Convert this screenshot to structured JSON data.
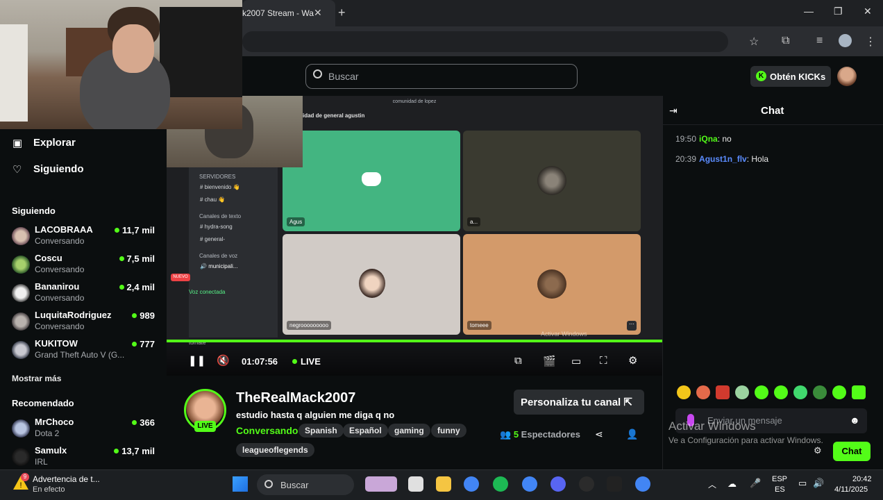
{
  "browser": {
    "tab_title": "k2007 Stream - Wa",
    "new_tab": "+",
    "close_tab": "✕",
    "window_controls": [
      "—",
      "❐",
      "✕"
    ]
  },
  "header": {
    "search_placeholder": "Buscar",
    "kicks_button": "Obtén KICKs"
  },
  "sidebar": {
    "nav": [
      {
        "label": "Explorar",
        "icon": "compass-icon"
      },
      {
        "label": "Siguiendo",
        "icon": "heart-icon"
      }
    ],
    "following_title": "Siguiendo",
    "following": [
      {
        "name": "LACOBRAAA",
        "category": "Conversando",
        "viewers": "11,7 mil"
      },
      {
        "name": "Coscu",
        "category": "Conversando",
        "viewers": "7,5 mil"
      },
      {
        "name": "Bananirou",
        "category": "Conversando",
        "viewers": "2,4 mil"
      },
      {
        "name": "LuquitaRodriguez",
        "category": "Conversando",
        "viewers": "989"
      },
      {
        "name": "KUKITOW",
        "category": "Grand Theft Auto V (G...",
        "viewers": "777"
      }
    ],
    "show_more": "Mostrar más",
    "recommended_title": "Recomendado",
    "recommended": [
      {
        "name": "MrChoco",
        "category": "Dota 2",
        "viewers": "366"
      },
      {
        "name": "Samulx",
        "category": "IRL",
        "viewers": "13,7 mil"
      }
    ]
  },
  "player": {
    "discord_window_title": "comunidad de lopez",
    "discord_channel_header": "idad de general agustin",
    "servers_label": "SERVIDORES",
    "channels": [
      "bienvenido 👋",
      "chau 👋"
    ],
    "text_channels_label": "Canales de texto",
    "text_channels": [
      "hydra-song",
      "general-"
    ],
    "voice_channels_label": "Canales de voz",
    "voice_channel": "municipali...",
    "voice_connected": "Voz conectada",
    "new_badge": "NUEVO",
    "user_label": "tomate",
    "tiles": [
      {
        "label": "Agus"
      },
      {
        "label": "a..."
      },
      {
        "label": "negrooooooooo"
      },
      {
        "label": "tomeee"
      }
    ],
    "windows_watermark": "Activar Windows",
    "windows_watermark_sub": "Ve a Configuración para activar Windows.",
    "time": "01:07:56",
    "live_label": "LIVE",
    "progress": 1.0
  },
  "stream": {
    "live_badge": "LIVE",
    "streamer": "TheRealMack2007",
    "title": "estudio hasta q alguien me diga q no",
    "category": "Conversando",
    "tags": [
      "Spanish",
      "Español",
      "gaming",
      "funny",
      "leagueoflegends"
    ],
    "customize_button": "Personaliza tu canal",
    "viewer_count": "5",
    "viewer_label": "Espectadores"
  },
  "chat": {
    "title": "Chat",
    "messages": [
      {
        "time": "19:50",
        "user": "iQna",
        "user_color": "#53fc18",
        "text": "no"
      },
      {
        "time": "20:39",
        "user": "Agust1n_flv",
        "user_color": "#5b8cff",
        "text": "Hola"
      }
    ],
    "input_placeholder": "Enviar un mensaje",
    "send_button": "Chat",
    "watermark_title": "Activar Windows",
    "watermark_sub": "Ve a Configuración para activar Windows."
  },
  "taskbar": {
    "warning_title": "Advertencia de t...",
    "warning_sub": "En efecto",
    "warning_badge": "9",
    "search_placeholder": "Buscar",
    "language": "ESP",
    "language_sub": "ES",
    "time": "20:42",
    "date": "4/11/2025"
  },
  "colors": {
    "accent": "#53fc18",
    "background": "#0b0e0f",
    "surface": "#2a2d30"
  }
}
